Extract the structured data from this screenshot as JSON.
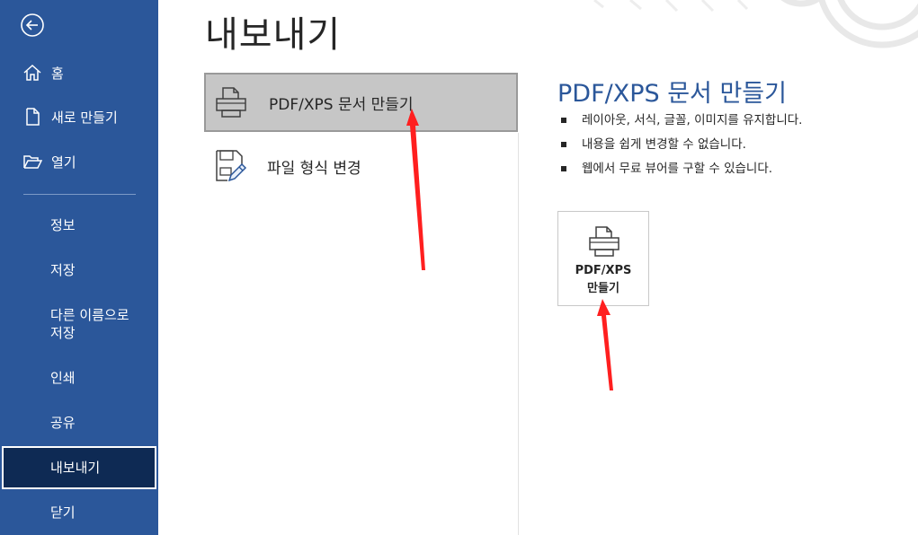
{
  "sidebar": {
    "top_items": [
      {
        "label": "홈",
        "icon": "home-icon"
      },
      {
        "label": "새로 만들기",
        "icon": "new-document-icon"
      },
      {
        "label": "열기",
        "icon": "folder-open-icon"
      }
    ],
    "items": [
      {
        "label": "정보"
      },
      {
        "label": "저장"
      },
      {
        "label": "다른 이름으로\n저장"
      },
      {
        "label": "인쇄"
      },
      {
        "label": "공유"
      },
      {
        "label": "내보내기"
      },
      {
        "label": "닫기"
      }
    ],
    "active_item": "내보내기"
  },
  "main": {
    "title": "내보내기",
    "options": [
      {
        "label": "PDF/XPS 문서 만들기",
        "icon": "printer-icon",
        "selected": true
      },
      {
        "label": "파일 형식 변경",
        "icon": "file-convert-icon",
        "selected": false
      }
    ]
  },
  "detail": {
    "title": "PDF/XPS 문서 만들기",
    "bullets": [
      "레이아웃, 서식, 글꼴, 이미지를 유지합니다.",
      "내용을 쉽게 변경할 수 없습니다.",
      "웹에서 무료 뷰어를 구할 수 있습니다."
    ],
    "button": {
      "line1": "PDF/XPS",
      "line2": "만들기",
      "icon": "printer-icon"
    }
  },
  "colors": {
    "sidebar_bg": "#2b579a",
    "sidebar_active_bg": "#0e2a54",
    "accent_title": "#2b579a",
    "selected_option_bg": "#c6c6c6",
    "annotation_arrow": "#ff1f1f"
  }
}
